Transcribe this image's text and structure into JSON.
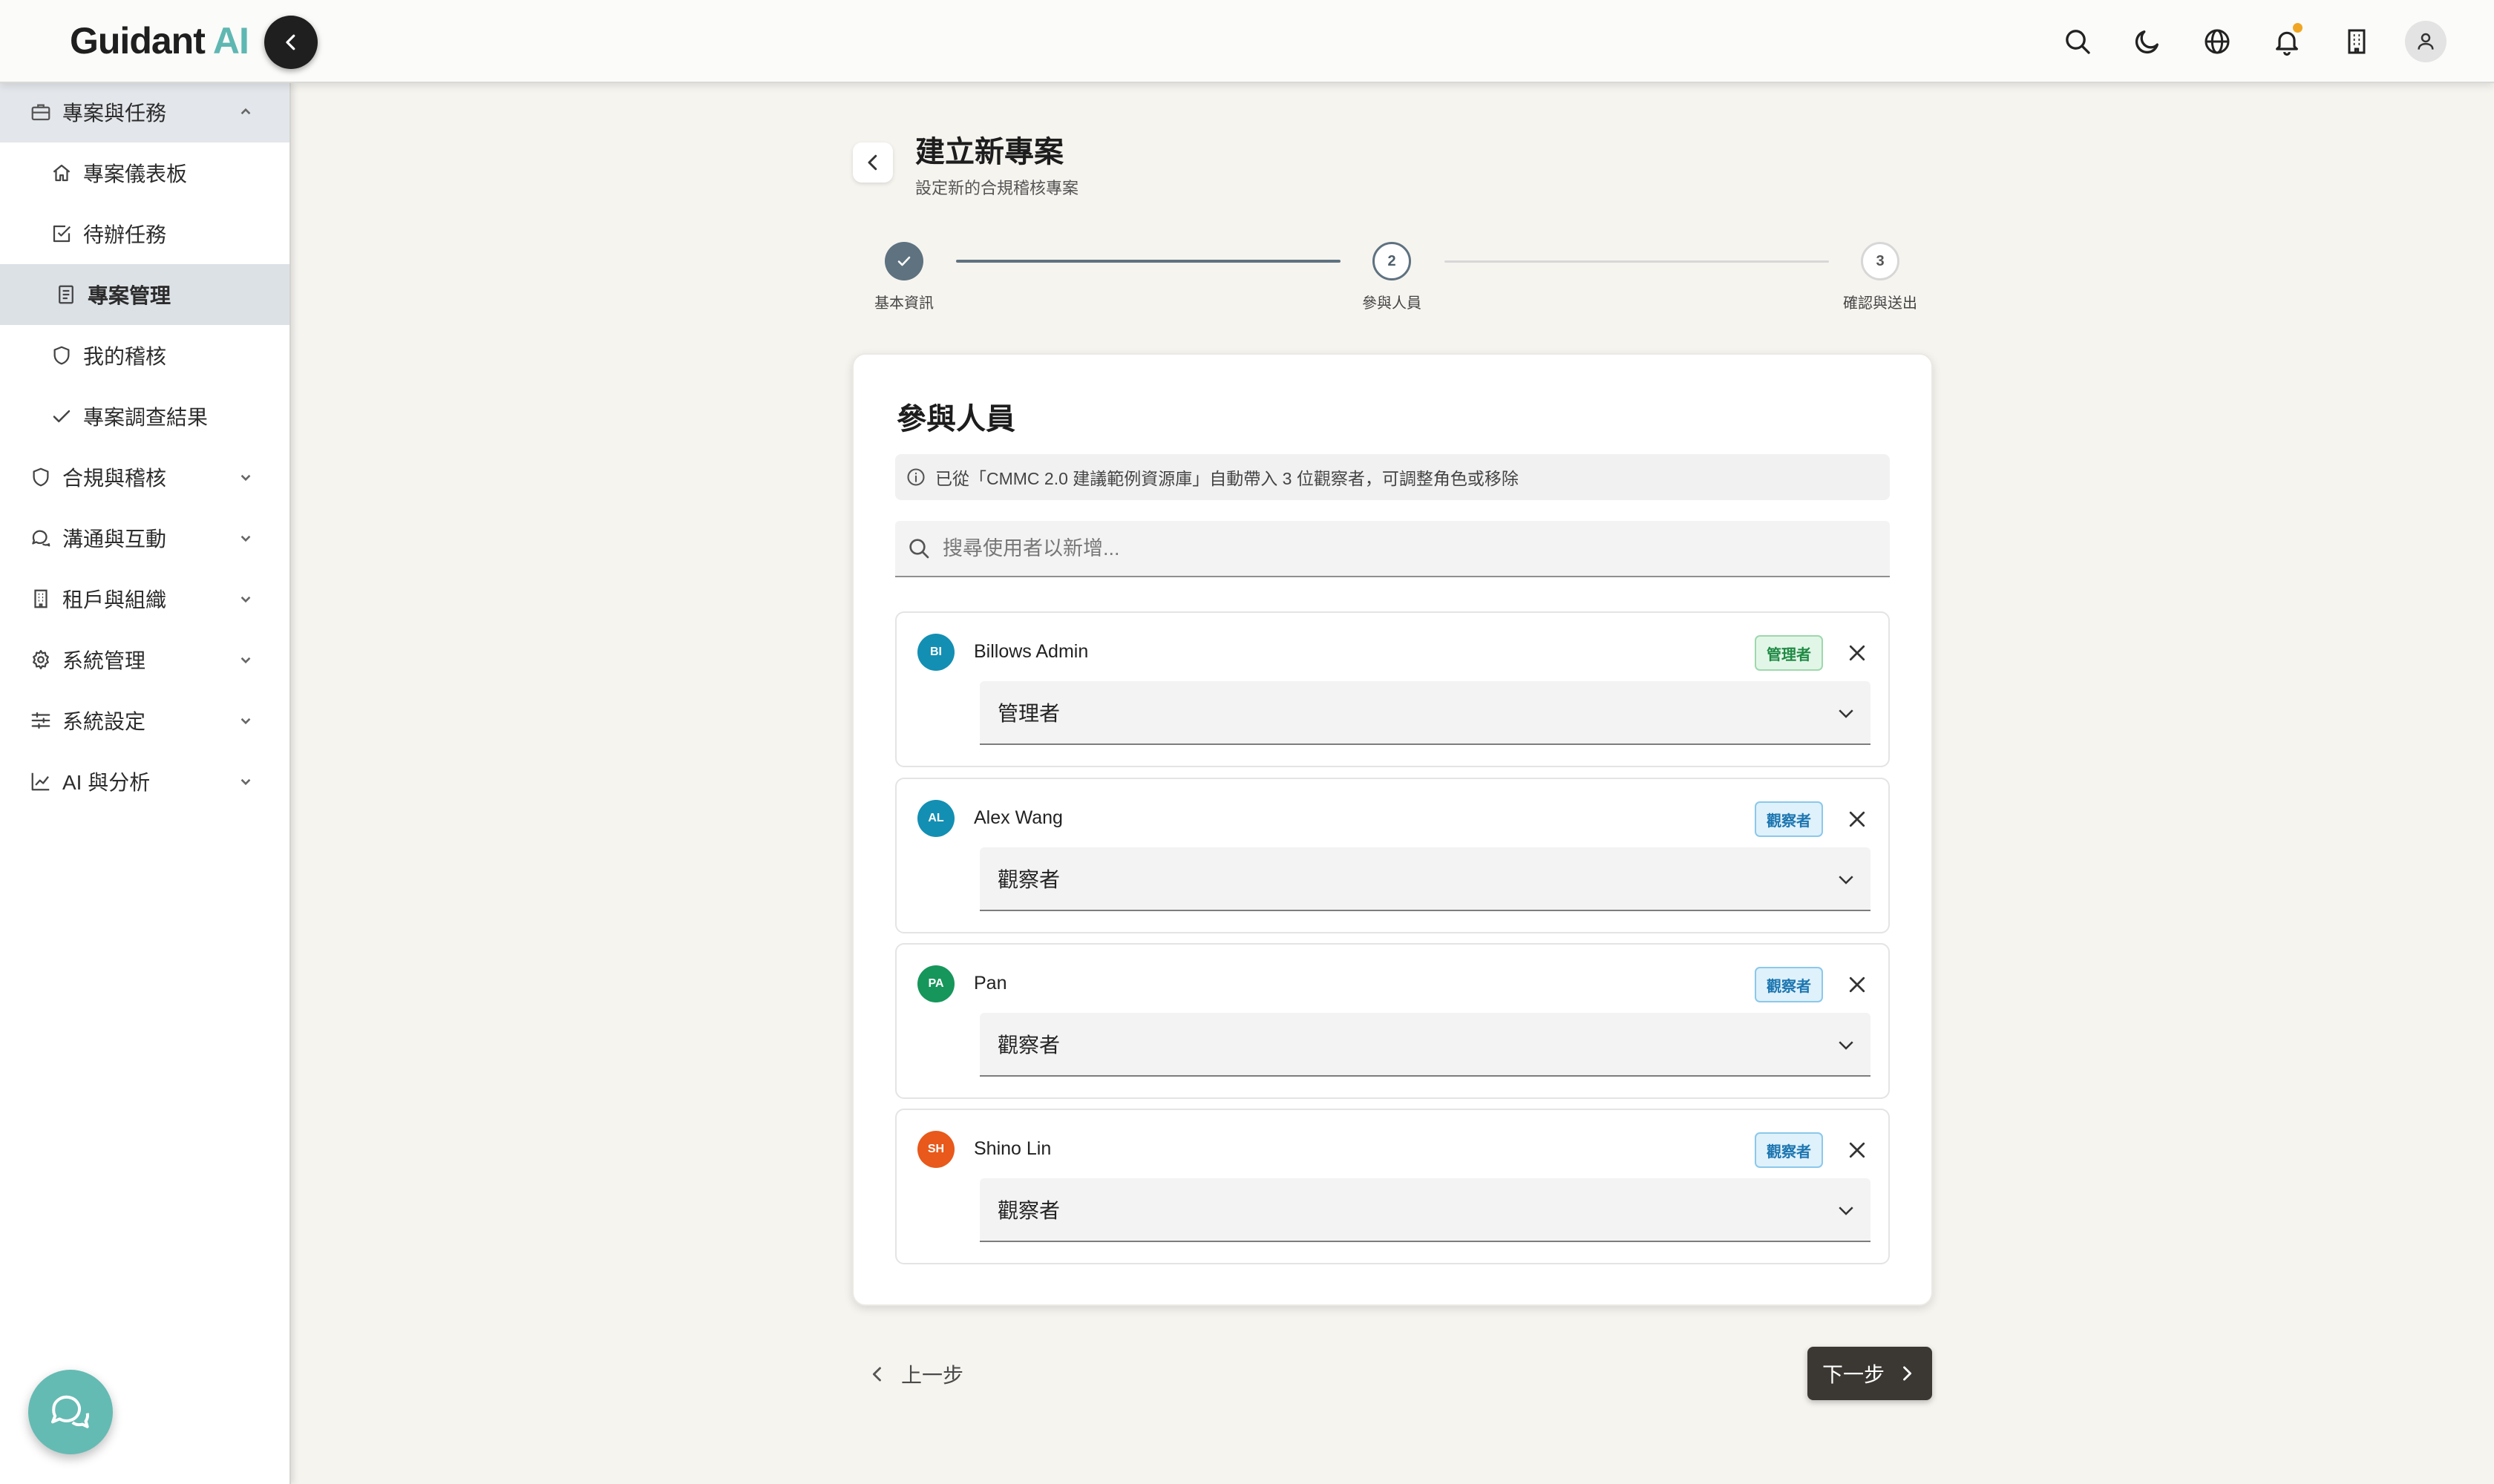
{
  "header": {
    "brand_main": "Guidant",
    "brand_accent": "AI",
    "icons": [
      "search-icon",
      "moon-icon",
      "globe-icon",
      "bell-icon",
      "building-icon",
      "user-icon"
    ]
  },
  "sidebar": {
    "groups": [
      {
        "label": "專案與任務",
        "icon": "briefcase-icon",
        "expanded": true
      },
      {
        "label": "合規與稽核",
        "icon": "shield-icon",
        "expanded": false
      },
      {
        "label": "溝通與互動",
        "icon": "chat-icon",
        "expanded": false
      },
      {
        "label": "租戶與組織",
        "icon": "building-icon",
        "expanded": false
      },
      {
        "label": "系統管理",
        "icon": "gear-icon",
        "expanded": false
      },
      {
        "label": "系統設定",
        "icon": "sliders-icon",
        "expanded": false
      },
      {
        "label": "AI 與分析",
        "icon": "chart-icon",
        "expanded": false
      }
    ],
    "sub_items": [
      {
        "label": "專案儀表板",
        "icon": "home-icon"
      },
      {
        "label": "待辦任務",
        "icon": "checkbox-icon"
      },
      {
        "label": "專案管理",
        "icon": "document-icon",
        "active": true
      },
      {
        "label": "我的稽核",
        "icon": "shield-icon"
      },
      {
        "label": "專案調查結果",
        "icon": "check-icon"
      }
    ]
  },
  "page": {
    "title": "建立新專案",
    "subtitle": "設定新的合規稽核專案"
  },
  "stepper": {
    "steps": [
      {
        "number": "1",
        "label": "基本資訊",
        "state": "done"
      },
      {
        "number": "2",
        "label": "參與人員",
        "state": "current"
      },
      {
        "number": "3",
        "label": "確認與送出",
        "state": "upcoming"
      }
    ]
  },
  "card": {
    "title": "參與人員",
    "info": "已從「CMMC 2.0 建議範例資源庫」自動帶入 3 位觀察者，可調整角色或移除",
    "search_placeholder": "搜尋使用者以新增..."
  },
  "members": [
    {
      "initials": "BI",
      "name": "Billows Admin",
      "badge": "管理者",
      "role": "管理者",
      "avatar_color": "#138fb3",
      "badge_type": "admin"
    },
    {
      "initials": "AL",
      "name": "Alex Wang",
      "badge": "觀察者",
      "role": "觀察者",
      "avatar_color": "#138fb3",
      "badge_type": "viewer"
    },
    {
      "initials": "PA",
      "name": "Pan",
      "badge": "觀察者",
      "role": "觀察者",
      "avatar_color": "#16965b",
      "badge_type": "viewer"
    },
    {
      "initials": "SH",
      "name": "Shino Lin",
      "badge": "觀察者",
      "role": "觀察者",
      "avatar_color": "#e8591b",
      "badge_type": "viewer"
    }
  ],
  "footer": {
    "prev_label": "上一步",
    "next_label": "下一步"
  },
  "colors": {
    "accent_teal": "#5fb7b2",
    "step_done": "#5e7280",
    "primary_button": "#3b3833",
    "notification_dot": "#f0a623"
  }
}
